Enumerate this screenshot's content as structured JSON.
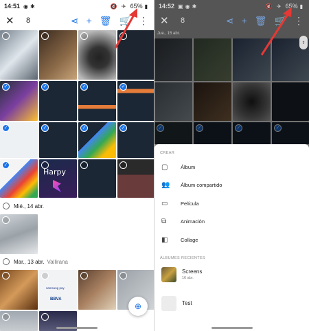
{
  "left": {
    "status": {
      "time": "14:51",
      "battery": "65%"
    },
    "toolbar": {
      "close_icon": "close-icon",
      "selected_count": "8"
    },
    "sections": [
      {
        "label": "Mié., 14 abr.",
        "location": ""
      },
      {
        "label": "Mar., 13 abr.",
        "location": "Vallirana"
      }
    ],
    "harpy_text": "Harpy",
    "samsungpay_text": "samsung pay",
    "bbva_text": "BBVA"
  },
  "right": {
    "status": {
      "time": "14:52",
      "battery": "65%"
    },
    "toolbar": {
      "selected_count": "8"
    },
    "date_strip": "Jue., 15 abr.",
    "sheet": {
      "create_heading": "CREAR",
      "options": [
        {
          "icon": "album-icon",
          "label": "Álbum"
        },
        {
          "icon": "shared-album-icon",
          "label": "Álbum compartido"
        },
        {
          "icon": "movie-icon",
          "label": "Película"
        },
        {
          "icon": "animation-icon",
          "label": "Animación"
        },
        {
          "icon": "collage-icon",
          "label": "Collage"
        }
      ],
      "recent_heading": "ÁLBUMES RECIENTES",
      "albums": [
        {
          "name": "Screens",
          "sub": "16 abr."
        },
        {
          "name": "Test",
          "sub": ""
        }
      ]
    }
  },
  "colors": {
    "accent": "#1a73e8",
    "arrow": "#e53935"
  }
}
